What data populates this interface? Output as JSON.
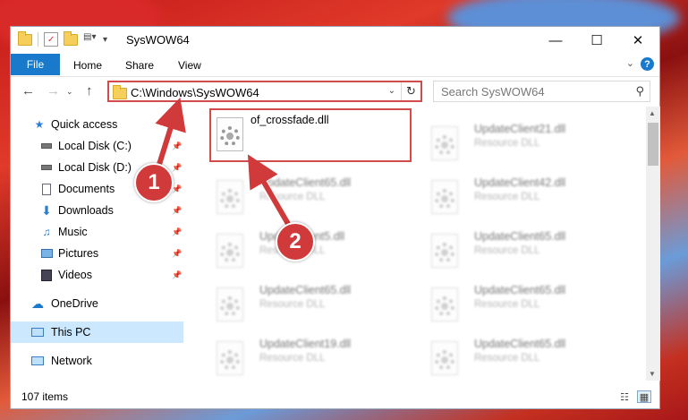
{
  "window": {
    "title": "SysWOW64"
  },
  "ribbon": {
    "tabs": [
      "File",
      "Home",
      "Share",
      "View"
    ],
    "help": "?"
  },
  "controls": {
    "minimize": "—",
    "maximize": "☐",
    "close": "✕"
  },
  "address": {
    "path": "C:\\Windows\\SysWOW64"
  },
  "search": {
    "placeholder": "Search SysWOW64"
  },
  "sidebar": {
    "items": [
      {
        "label": "Quick access",
        "icon": "star-icon"
      },
      {
        "label": "Local Disk (C:)",
        "icon": "drive-icon"
      },
      {
        "label": "Local Disk (D:)",
        "icon": "drive-icon"
      },
      {
        "label": "Documents",
        "icon": "documents-icon"
      },
      {
        "label": "Downloads",
        "icon": "download-icon"
      },
      {
        "label": "Music",
        "icon": "music-icon"
      },
      {
        "label": "Pictures",
        "icon": "pictures-icon"
      },
      {
        "label": "Videos",
        "icon": "videos-icon"
      },
      {
        "label": "OneDrive",
        "icon": "cloud-icon"
      },
      {
        "label": "This PC",
        "icon": "computer-icon"
      },
      {
        "label": "Network",
        "icon": "network-icon"
      }
    ]
  },
  "files": {
    "highlighted": {
      "name": "of_crossfade.dll"
    },
    "left": [
      {
        "name": "UpdateClient65.dll",
        "type": "Resource DLL"
      },
      {
        "name": "UpdateClient5.dll",
        "type": "Resource DLL"
      },
      {
        "name": "UpdateClient65.dll",
        "type": "Resource DLL"
      },
      {
        "name": "UpdateClient19.dll",
        "type": "Resource DLL"
      }
    ],
    "right": [
      {
        "name": "UpdateClient21.dll",
        "type": "Resource DLL"
      },
      {
        "name": "UpdateClient42.dll",
        "type": "Resource DLL"
      },
      {
        "name": "UpdateClient65.dll",
        "type": "Resource DLL"
      },
      {
        "name": "UpdateClient65.dll",
        "type": "Resource DLL"
      },
      {
        "name": "UpdateClient65.dll",
        "type": "Resource DLL"
      }
    ]
  },
  "status": {
    "items": "107 items"
  },
  "callouts": {
    "one": "1",
    "two": "2"
  },
  "colors": {
    "accent": "#1979ca",
    "highlight": "#d24b4b",
    "selected": "#cce8ff"
  }
}
